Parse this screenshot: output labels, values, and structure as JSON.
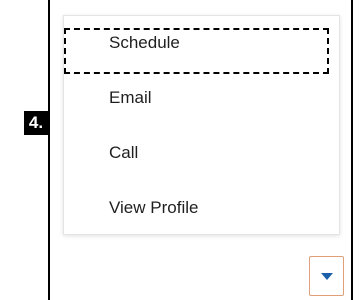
{
  "step": {
    "label": "4."
  },
  "menu": {
    "items": [
      {
        "label": "Schedule",
        "highlighted": true
      },
      {
        "label": "Email",
        "highlighted": false
      },
      {
        "label": "Call",
        "highlighted": false
      },
      {
        "label": "View Profile",
        "highlighted": false
      }
    ]
  },
  "dropdown": {
    "icon": "caret-down-icon",
    "border_color": "#e0a17a",
    "icon_color": "#1a5fa8"
  }
}
